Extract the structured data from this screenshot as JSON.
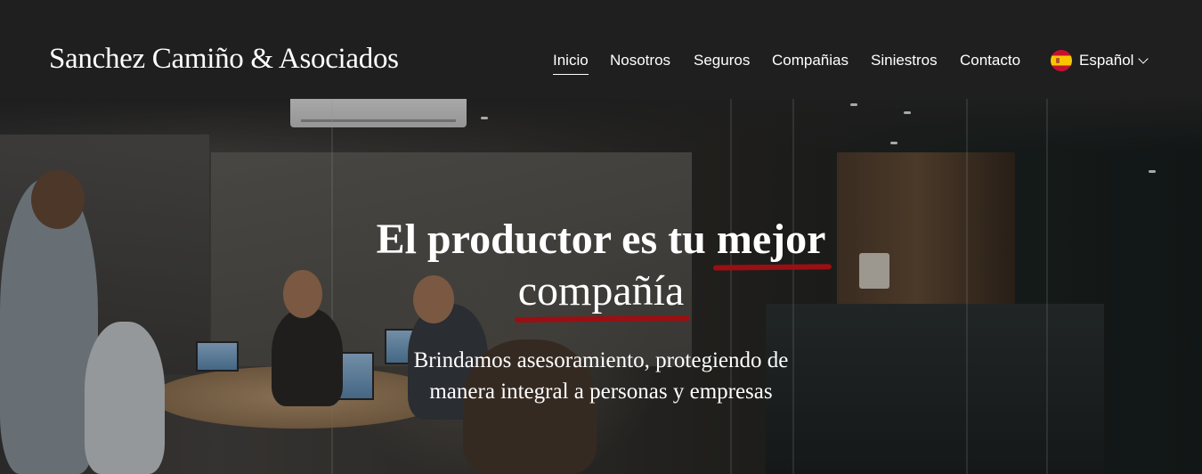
{
  "header": {
    "brand": "Sanchez Camiño & Asociados",
    "nav": [
      {
        "label": "Inicio",
        "active": true
      },
      {
        "label": "Nosotros",
        "active": false
      },
      {
        "label": "Seguros",
        "active": false
      },
      {
        "label": "Compañias",
        "active": false
      },
      {
        "label": "Siniestros",
        "active": false
      },
      {
        "label": "Contacto",
        "active": false
      }
    ],
    "language": {
      "label": "Español",
      "flag_icon": "spain-flag-icon"
    }
  },
  "hero": {
    "headline_line1_pre": "El productor es tu ",
    "headline_line1_highlight": "mejor",
    "headline_line2_highlight": "compañía",
    "subtitle_line1": "Brindamos asesoramiento, protegiendo de",
    "subtitle_line2": "manera integral a personas y empresas",
    "accent_color": "#9b0f13"
  }
}
